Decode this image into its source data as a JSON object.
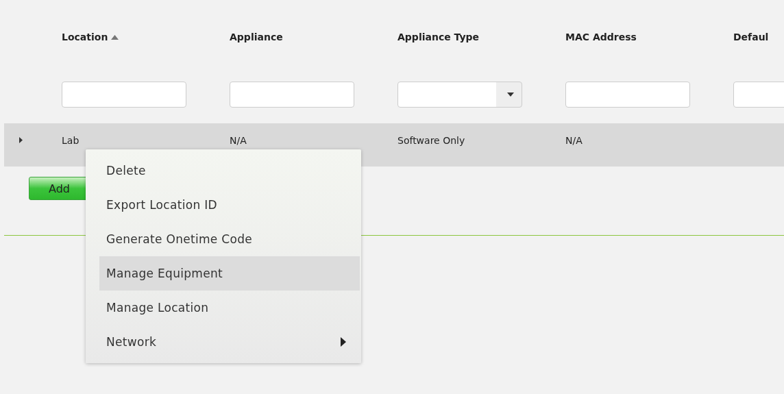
{
  "columns": [
    {
      "label": "Location",
      "sorted": true,
      "filter": {
        "kind": "text"
      }
    },
    {
      "label": "Appliance",
      "sorted": false,
      "filter": {
        "kind": "text"
      }
    },
    {
      "label": "Appliance Type",
      "sorted": false,
      "filter": {
        "kind": "select"
      }
    },
    {
      "label": "MAC Address",
      "sorted": false,
      "filter": {
        "kind": "text"
      }
    },
    {
      "label": "Defaul",
      "sorted": false,
      "filter": {
        "kind": "text"
      }
    }
  ],
  "rows": [
    {
      "expanded": false,
      "cells": [
        "Lab",
        "N/A",
        "Software Only",
        "N/A"
      ]
    }
  ],
  "add_button": {
    "label": "Add"
  },
  "context_menu": {
    "items": [
      {
        "label": "Delete",
        "selected": false,
        "submenu": false
      },
      {
        "label": "Export Location ID",
        "selected": false,
        "submenu": false
      },
      {
        "label": "Generate Onetime Code",
        "selected": false,
        "submenu": false
      },
      {
        "label": "Manage Equipment",
        "selected": true,
        "submenu": false
      },
      {
        "label": "Manage Location",
        "selected": false,
        "submenu": false
      },
      {
        "label": "Network",
        "selected": false,
        "submenu": true
      }
    ]
  }
}
